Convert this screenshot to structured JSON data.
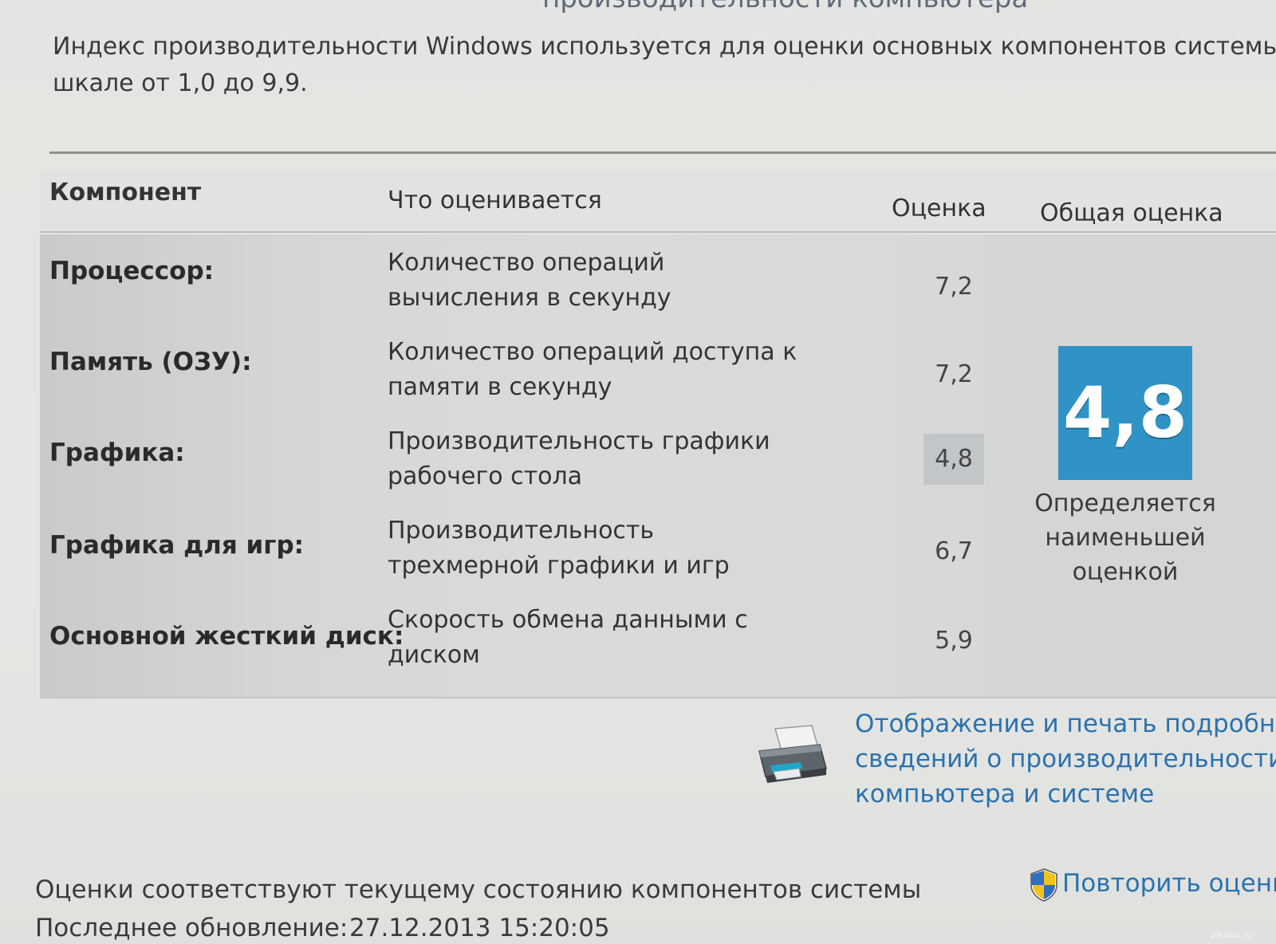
{
  "window": {
    "title_partial": "производительности компьютера"
  },
  "intro": {
    "line1": "Индекс производительности Windows используется для оценки основных компонентов системы по",
    "line2": "шкале от 1,0 до 9,9."
  },
  "table": {
    "headers": {
      "component": "Компонент",
      "what": "Что оценивается",
      "score": "Оценка",
      "total": "Общая оценка"
    },
    "rows": [
      {
        "component": "Процессор:",
        "desc1": "Количество операций",
        "desc2": "вычисления в секунду",
        "score": "7,2"
      },
      {
        "component": "Память (ОЗУ):",
        "desc1": "Количество операций доступа к",
        "desc2": "памяти в секунду",
        "score": "7,2"
      },
      {
        "component": "Графика:",
        "desc1": "Производительность графики",
        "desc2": "рабочего стола",
        "score": "4,8"
      },
      {
        "component": "Графика для игр:",
        "desc1": "Производительность",
        "desc2": "трехмерной графики и игр",
        "score": "6,7"
      },
      {
        "component": "Основной жесткий диск:",
        "desc1": "Скорость обмена данными с",
        "desc2": "диском",
        "score": "5,9"
      }
    ],
    "base_score": "4,8",
    "base_caption": {
      "line1": "Определяется",
      "line2": "наименьшей",
      "line3": "оценкой"
    }
  },
  "print_link": {
    "line1": "Отображение и печать подробных",
    "line2": "сведений о производительности",
    "line3": "компьютера и системе"
  },
  "footer": {
    "note": "Оценки соответствуют текущему состоянию компонентов системы",
    "date_label": "Последнее обновление:",
    "date_value": "27.12.2013 15:20:05",
    "rerun": "Повторить оценку"
  },
  "watermark": "pikabu.ru",
  "colors": {
    "badge": "#2f93c5",
    "link": "#2a72b0"
  },
  "icons": [
    "printer-icon",
    "shield-icon"
  ]
}
